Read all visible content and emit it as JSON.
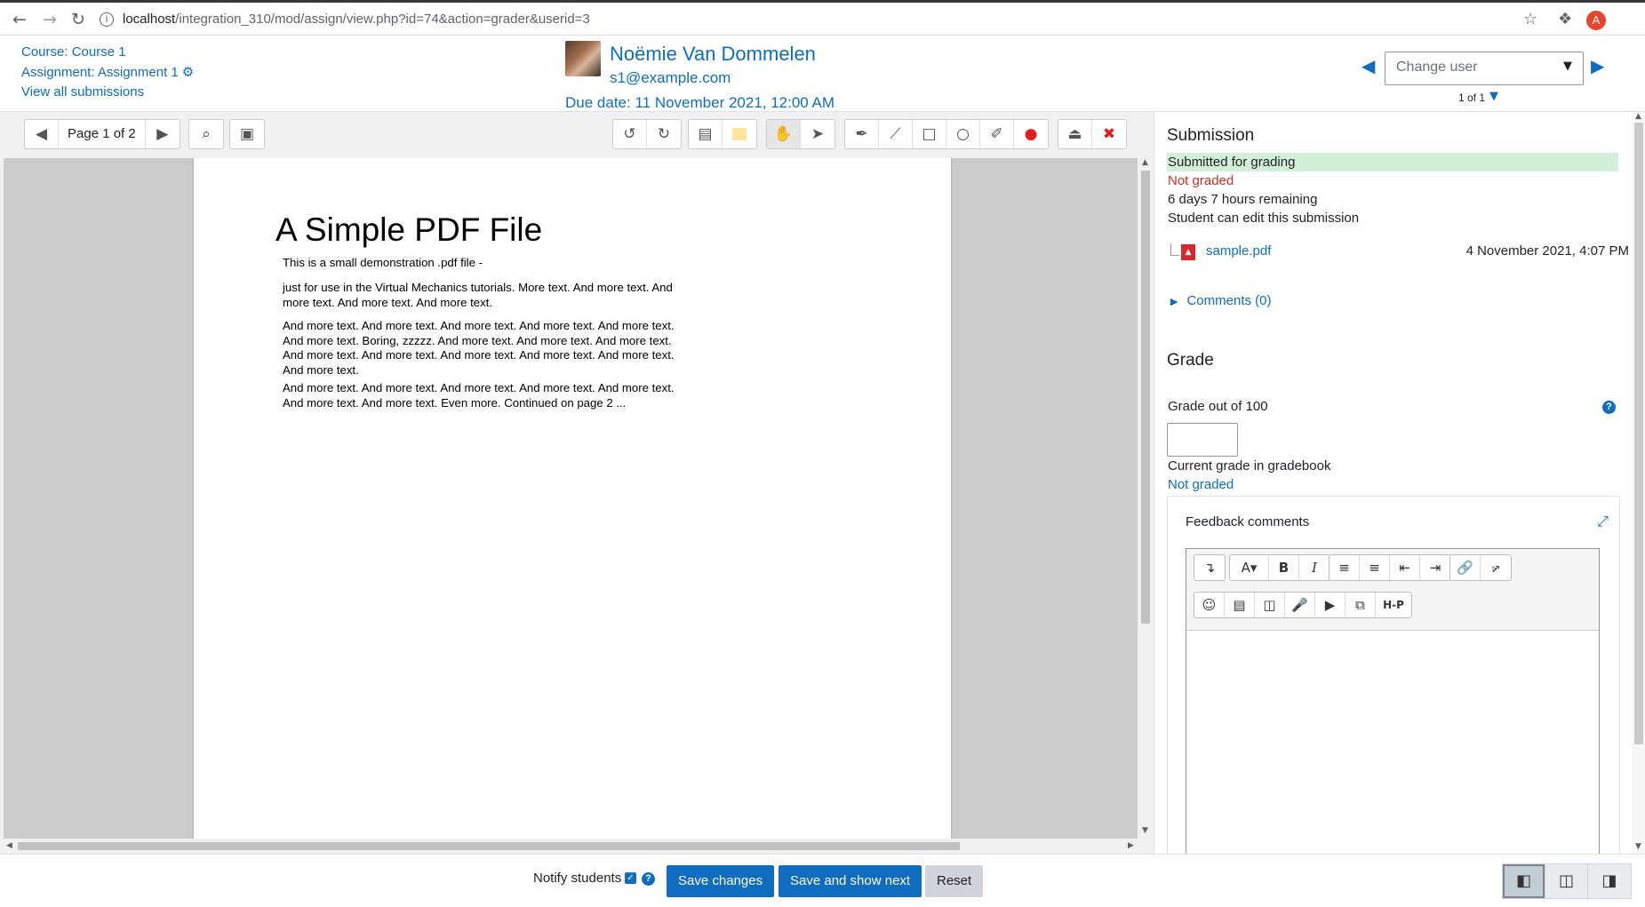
{
  "browser": {
    "url_host": "localhost",
    "url_path": "/integration_310/mod/assign/view.php?id=74&action=grader&userid=3",
    "profile_initial": "A"
  },
  "header": {
    "course_link": "Course: Course 1",
    "assignment_link": "Assignment: Assignment 1",
    "view_all_link": "View all submissions",
    "user_name": "Noëmie Van Dommelen",
    "user_email": "s1@example.com",
    "due_date": "Due date: 11 November 2021, 12:00 AM",
    "change_user_placeholder": "Change user",
    "user_count": "1 of 1"
  },
  "pdf_toolbar": {
    "page_label": "Page 1 of 2"
  },
  "pdf": {
    "title": "A Simple PDF File",
    "paragraphs": [
      "This is a small demonstration .pdf file -",
      "just for use in the Virtual Mechanics tutorials. More text. And more text. And more text. And more text. And more text.",
      "And more text. And more text. And more text. And more text. And more text. And more text. Boring, zzzzz. And more text. And more text. And more text. And more text. And more text. And more text. And more text. And more text. And more text.",
      "And more text. And more text. And more text. And more text. And more text. And more text. And more text. Even more. Continued on page 2 ..."
    ]
  },
  "submission": {
    "heading": "Submission",
    "status": "Submitted for grading",
    "grading_status": "Not graded",
    "time_remaining": "6 days 7 hours remaining",
    "edit_status": "Student can edit this submission",
    "file_name": "sample.pdf",
    "file_date": "4 November 2021, 4:07 PM",
    "comments_link": "Comments (0)"
  },
  "grade": {
    "heading": "Grade",
    "grade_label": "Grade out of 100",
    "grade_value": "",
    "gradebook_label": "Current grade in gradebook",
    "gradebook_value": "Not graded",
    "feedback_label": "Feedback comments"
  },
  "footer": {
    "notify_label": "Notify students",
    "save_changes": "Save changes",
    "save_next": "Save and show next",
    "reset": "Reset"
  },
  "colors": {
    "link": "#0f6cbf",
    "submitted_bg": "#d2f0d7",
    "not_graded": "#ca3120"
  }
}
